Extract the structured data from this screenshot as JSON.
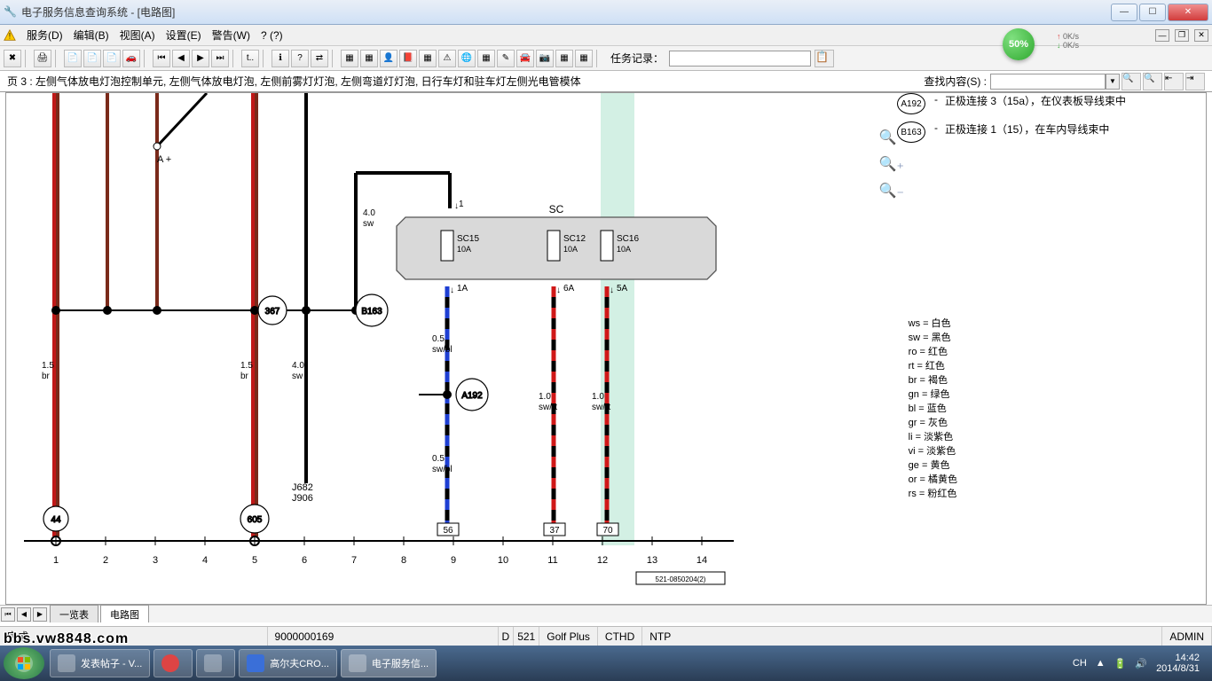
{
  "window": {
    "title": "电子服务信息查询系统 - [电路图]",
    "min": "—",
    "max": "☐",
    "close": "✕"
  },
  "menu": {
    "items": [
      "服务(D)",
      "编辑(B)",
      "视图(A)",
      "设置(E)",
      "警告(W)",
      "? (?)"
    ]
  },
  "speed": {
    "up": "0K/s",
    "down": "0K/s",
    "badge": "50%"
  },
  "toolbar": {
    "task_label": "任务记录：",
    "task_value": ""
  },
  "pagebar": {
    "desc": "页 3 : 左侧气体放电灯泡控制单元, 左侧气体放电灯泡, 左侧前雾灯灯泡, 左侧弯道灯灯泡, 日行车灯和驻车灯左侧光电管模体",
    "search_label": "查找内容(S) :",
    "search_value": ""
  },
  "notes": [
    {
      "ref": "A192",
      "dash": "-",
      "text": "正极连接 3（15a），在仪表板导线束中"
    },
    {
      "ref": "B163",
      "dash": "-",
      "text": "正极连接 1（15），在车内导线束中"
    }
  ],
  "legend": [
    "ws = 白色",
    "sw = 黑色",
    "ro = 红色",
    "rt = 红色",
    "br = 褐色",
    "gn = 绿色",
    "bl = 蓝色",
    "gr = 灰色",
    "li  = 淡紫色",
    "vi  = 淡紫色",
    "ge = 黄色",
    "or = 橘黄色",
    "rs = 粉红色"
  ],
  "diagram": {
    "axis_numbers": [
      "1",
      "2",
      "3",
      "4",
      "5",
      "6",
      "7",
      "8",
      "9",
      "10",
      "11",
      "12",
      "13",
      "14"
    ],
    "anno_left": "A   +",
    "wires": {
      "br_15_a": "1.5\nbr",
      "br_15_b": "1.5\nbr",
      "sw_40_a": "4.0\nsw",
      "sw_40_b": "4.0\nsw",
      "swbl_05_a": "0.5\nsw/bl",
      "swbl_05_b": "0.5\nsw/bl",
      "swrt_10_a": "1.0\nsw/rt",
      "swrt_10_b": "1.0\nsw/rt"
    },
    "nodes": {
      "n367": "367",
      "n44": "44",
      "n605": "605",
      "nB163": "B163",
      "nA192": "A192"
    },
    "sc_box": {
      "title": "SC",
      "pin_top": "1",
      "fuses": [
        {
          "name": "SC15",
          "rating": "10A",
          "pin": "1A"
        },
        {
          "name": "SC12",
          "rating": "10A",
          "pin": "6A"
        },
        {
          "name": "SC16",
          "rating": "10A",
          "pin": "5A"
        }
      ]
    },
    "j_labels": "J682\nJ906",
    "terminals": [
      "56",
      "37",
      "70"
    ],
    "footer_code": "521-0850204(2)"
  },
  "doctabs": {
    "tab1": "一览表",
    "tab2": "电路图"
  },
  "status": {
    "msg": "完成",
    "code": "9000000169",
    "d": "D",
    "num": "521",
    "model": "Golf Plus",
    "cthd": "CTHD",
    "ntp": "NTP",
    "user": "ADMIN"
  },
  "taskbar": {
    "items": [
      "",
      "发表帖子 - V...",
      "",
      "",
      "高尔夫CRO...",
      "电子服务信..."
    ],
    "ime": "CH",
    "time": "14:42",
    "date": "2014/8/31"
  },
  "watermark": "bbs.vw8848.com"
}
